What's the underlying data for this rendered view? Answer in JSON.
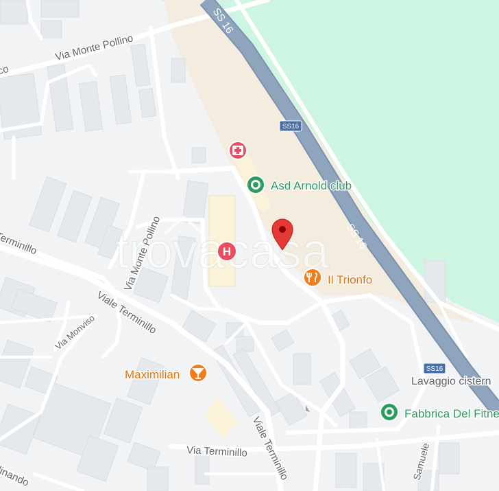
{
  "map": {
    "colors": {
      "background": "#f1f3f4",
      "park": "#cdf5e1",
      "sand": "#f3ecdf",
      "highway": "#8fa4bd",
      "road": "#ffffff",
      "road_casing": "#d5dce6",
      "building": "#e5e8ec",
      "building_edge": "#d9dde2",
      "hospital_area": "#fbf3d9",
      "poi_red": "#ea4d5f",
      "poi_green": "#2c9d5e",
      "poi_orange": "#f07d1b",
      "pin_red": "#e53935",
      "label_gray": "#5f6368"
    },
    "roads": {
      "ss16_label": "SS 16",
      "ss16_shield": "SS16",
      "via_monte_pollino": "Via Monte Pollino",
      "viale_terminillo": "Viale Terminillo",
      "terminillo_left": "Terminillo",
      "via_monviso": "Via Monviso",
      "via_terminillo": "Via Terminillo",
      "samuele": "Samuele",
      "linando": "linando",
      "edge_co": "co"
    },
    "pois": {
      "arnold": "Asd Arnold club",
      "trionfo": "Il Trionfo",
      "maximilian": "Maximilian",
      "fabbrica": "Fabbrica Del Fitne",
      "lavaggio": "Lavaggio cistern",
      "hospital_letter": "H"
    },
    "watermark": "trovacasa",
    "icons": {
      "hospital": "hospital-cross-icon",
      "hospital_h": "hospital-h-icon",
      "pin": "location-pin-icon",
      "gym": "dot-circle-icon",
      "restaurant": "fork-knife-icon",
      "bar": "cocktail-glass-icon"
    }
  }
}
